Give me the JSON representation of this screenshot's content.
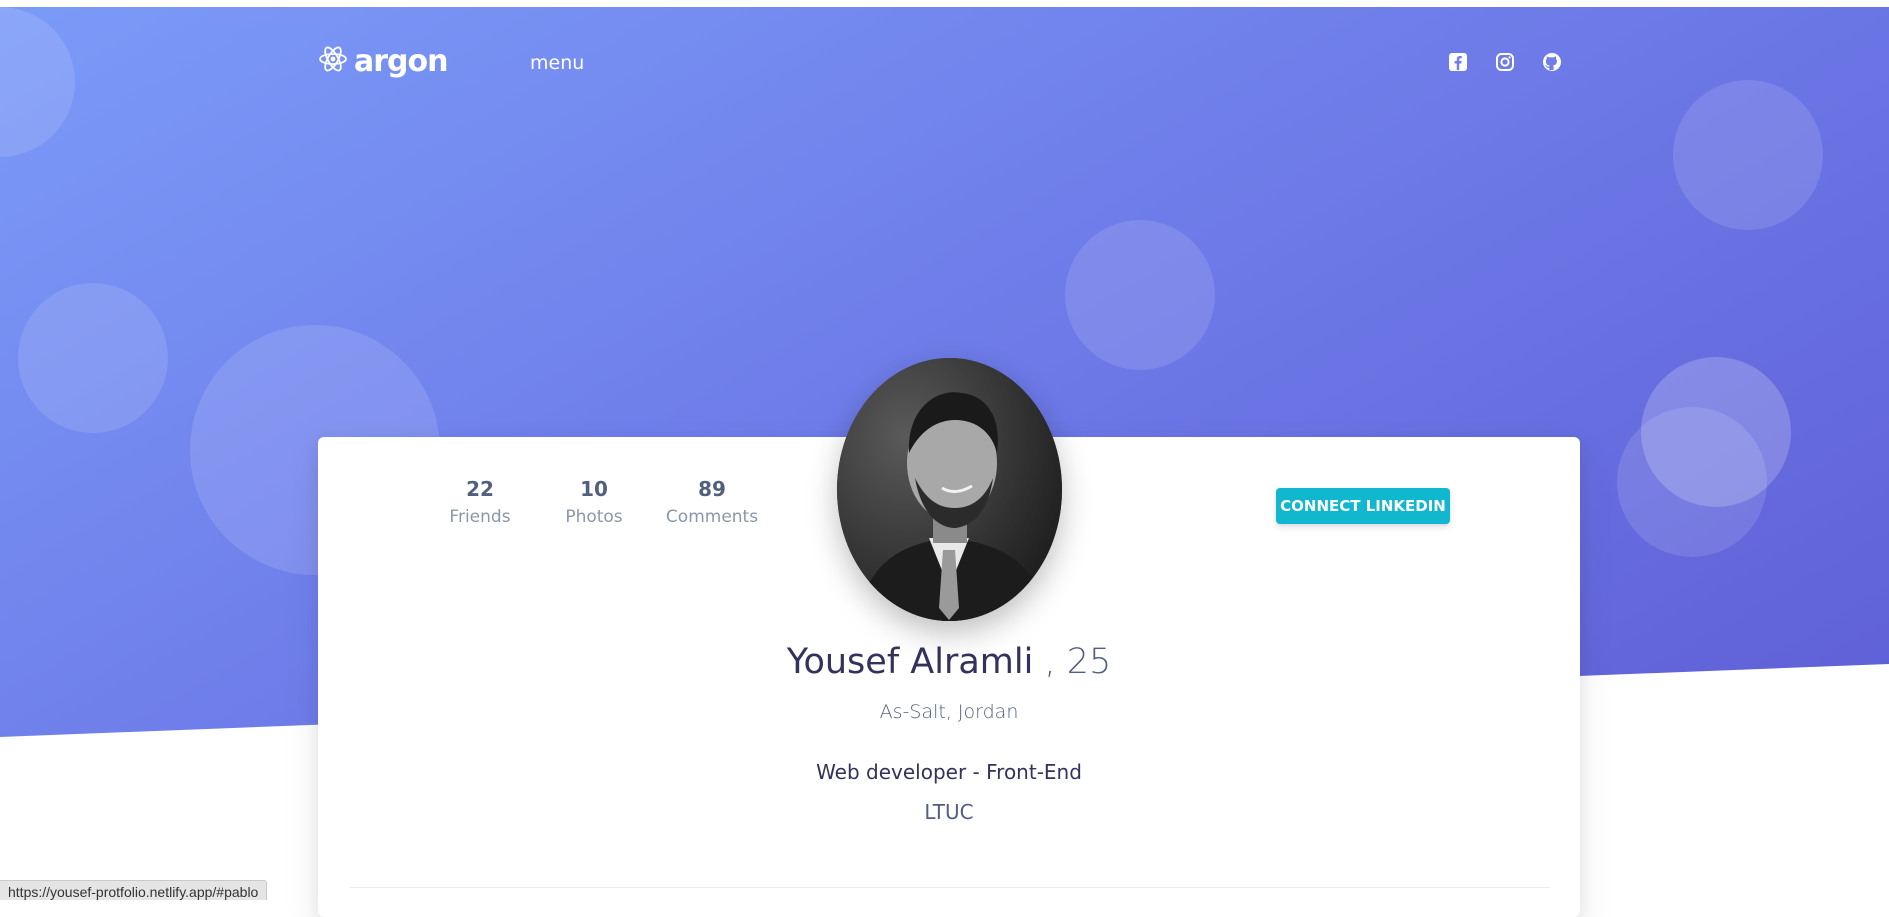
{
  "nav": {
    "logo_text": "argon",
    "menu_label": "menu",
    "social_icons": [
      "facebook-square-icon",
      "instagram-icon",
      "github-icon"
    ]
  },
  "stats": [
    {
      "value": "22",
      "label": "Friends"
    },
    {
      "value": "10",
      "label": "Photos"
    },
    {
      "value": "89",
      "label": "Comments"
    }
  ],
  "connect_button": "CONNECT LINKEDIN",
  "profile": {
    "name": "Yousef Alramli",
    "age": ", 25",
    "location": "As-Salt, Jordan",
    "job_title": "Web developer - Front-End",
    "organization": "LTUC"
  },
  "status_bar": {
    "url": "https://yousef-protfolio.netlify.app/#pablo"
  },
  "colors": {
    "hero_gradient_start": "#7b9bf8",
    "hero_gradient_end": "#5f5fd6",
    "button_info": "#11b6cf",
    "heading": "#32325d",
    "muted": "#8898aa"
  }
}
